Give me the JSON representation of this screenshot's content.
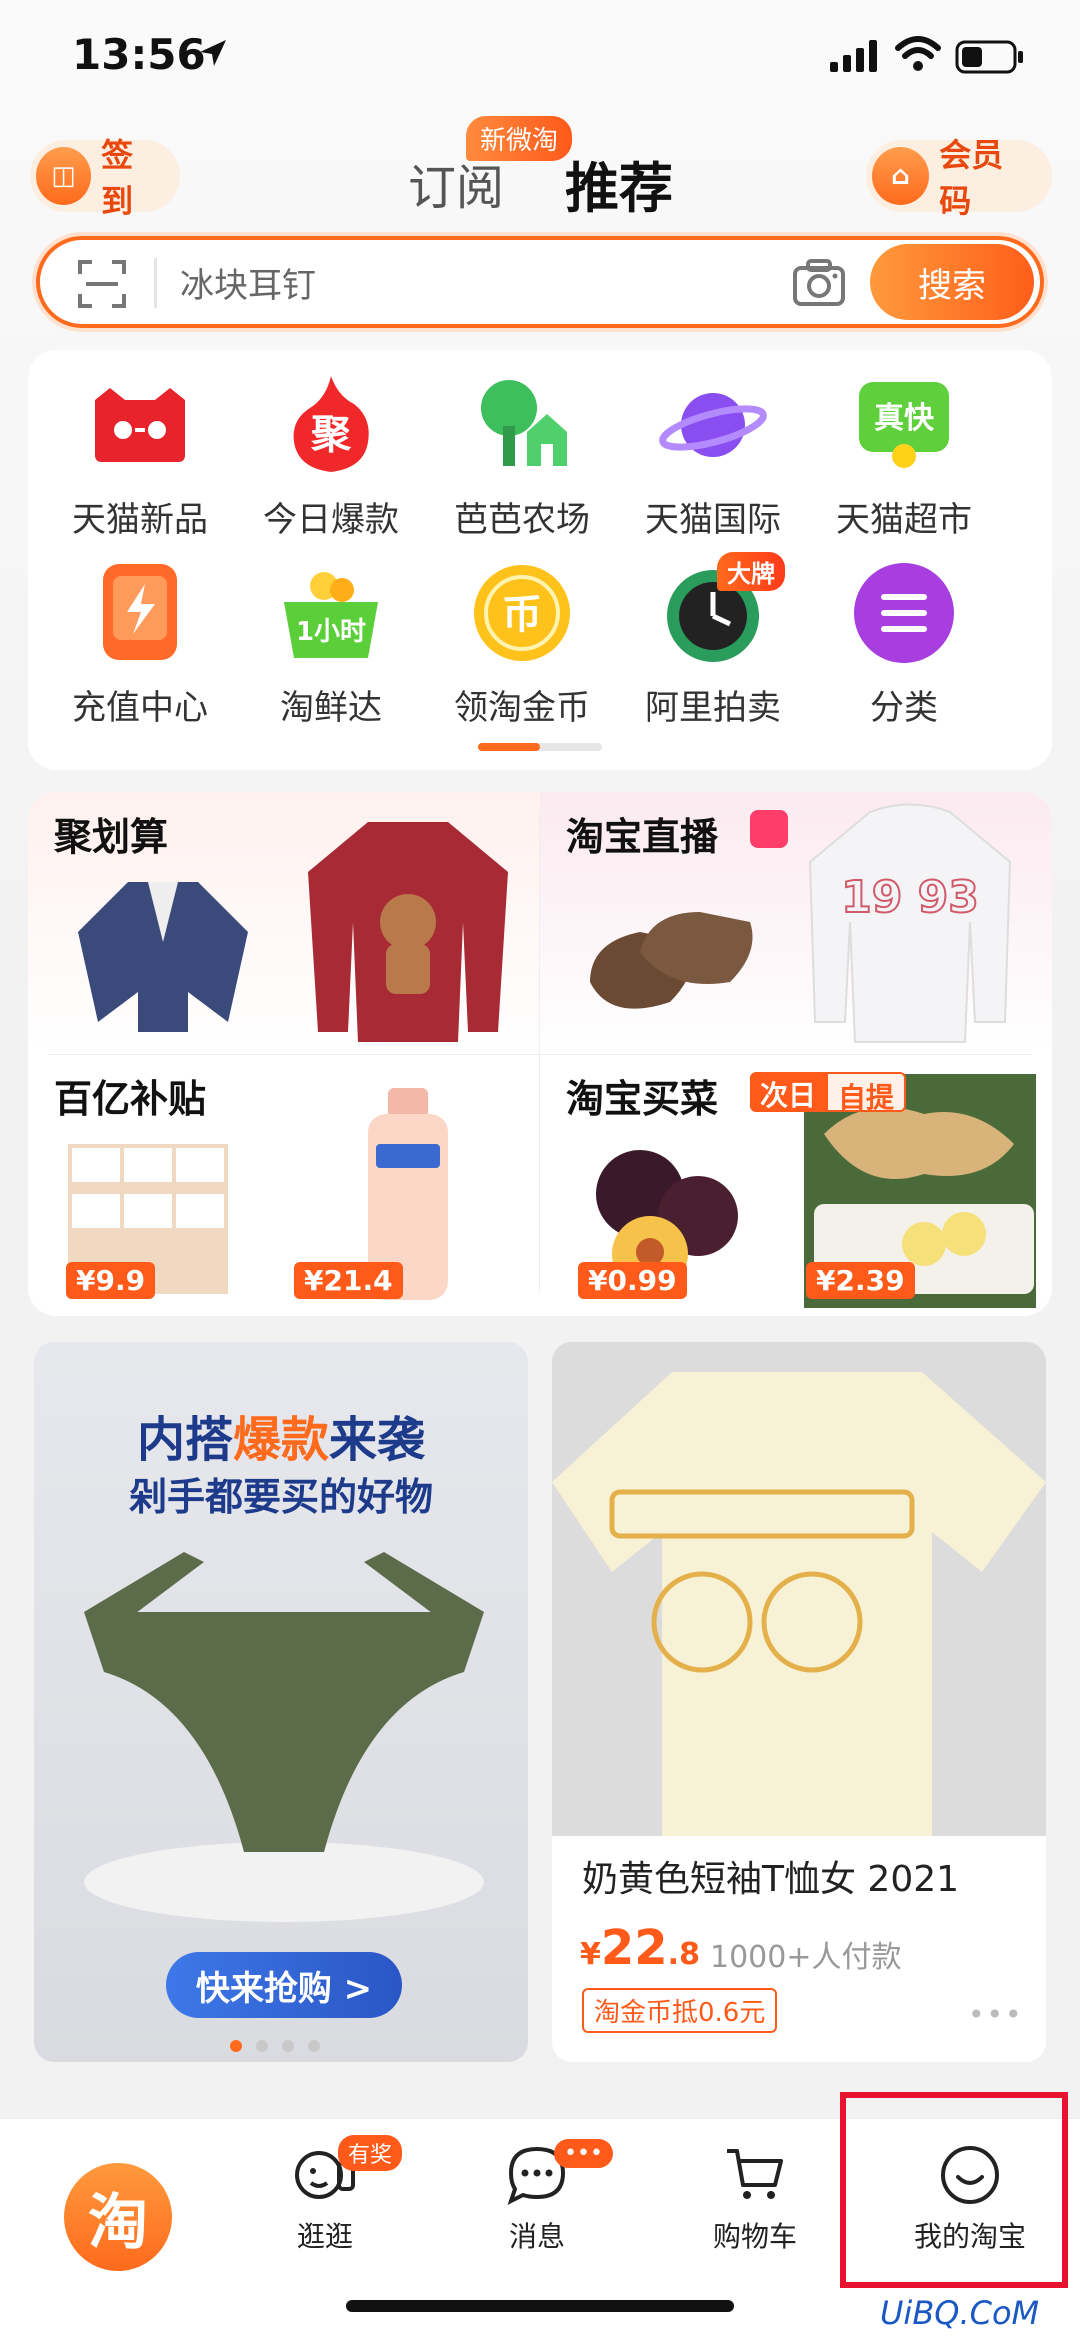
{
  "status_bar": {
    "time": "13:56"
  },
  "header": {
    "signin_label": "签到",
    "tab_follow": "订阅",
    "tab_follow_badge": "新微淘",
    "tab_recommend": "推荐",
    "member_code_label": "会员码"
  },
  "search": {
    "placeholder": "冰块耳钉",
    "button_label": "搜索"
  },
  "grid": {
    "items": [
      {
        "label": "天猫新品",
        "icon": "tmall-cat-icon",
        "color": "#e8232c"
      },
      {
        "label": "今日爆款",
        "icon": "fire-ju-icon",
        "color": "#f0282a"
      },
      {
        "label": "芭芭农场",
        "icon": "tree-farm-icon",
        "color": "#3cbf5c"
      },
      {
        "label": "天猫国际",
        "icon": "planet-icon",
        "color": "#8a4ef0"
      },
      {
        "label": "天猫超市",
        "icon": "supermarket-icon",
        "color": "#5fcf3c"
      },
      {
        "label": "充值中心",
        "icon": "lightning-phone-icon",
        "color": "#ff6a2a"
      },
      {
        "label": "淘鲜达",
        "icon": "basket-icon",
        "color": "#5bcf3a"
      },
      {
        "label": "领淘金币",
        "icon": "gold-coin-icon",
        "color": "#ffc21a"
      },
      {
        "label": "阿里拍卖",
        "icon": "clock-icon",
        "color": "#2a9c5c"
      },
      {
        "label": "分类",
        "icon": "menu-icon",
        "color": "#a83ee0"
      }
    ],
    "auction_badge": "大牌",
    "supermarket_badge": "真快",
    "basket_text": "1小时",
    "coin_text": "币",
    "flame_text": "聚"
  },
  "promo": {
    "juhuasuan": "聚划算",
    "live": "淘宝直播",
    "subsidy": "百亿补贴",
    "grocery": "淘宝买菜",
    "grocery_badge_1": "次日",
    "grocery_badge_2": "自提",
    "prices": [
      "¥9.9",
      "¥21.4",
      "¥0.99",
      "¥2.39"
    ],
    "hoodie_text": "19 93"
  },
  "feed": {
    "ad": {
      "line1_a": "内搭",
      "line1_hl": "爆款",
      "line1_b": "来袭",
      "line2": "剁手都要买的好物",
      "button": "快来抢购 >"
    },
    "product": {
      "title": "奶黄色短袖T恤女 2021",
      "currency": "¥",
      "price_int": "22",
      "price_dec": ".8",
      "sold": "1000+人付款",
      "coupon": "淘金币抵0.6元",
      "more": "•••"
    }
  },
  "tabbar": {
    "home_glyph": "淘",
    "items": [
      "逛逛",
      "消息",
      "购物车",
      "我的淘宝"
    ],
    "guang_badge": "有奖",
    "message_badge": "•••"
  },
  "watermark": "UiBQ.CoM"
}
